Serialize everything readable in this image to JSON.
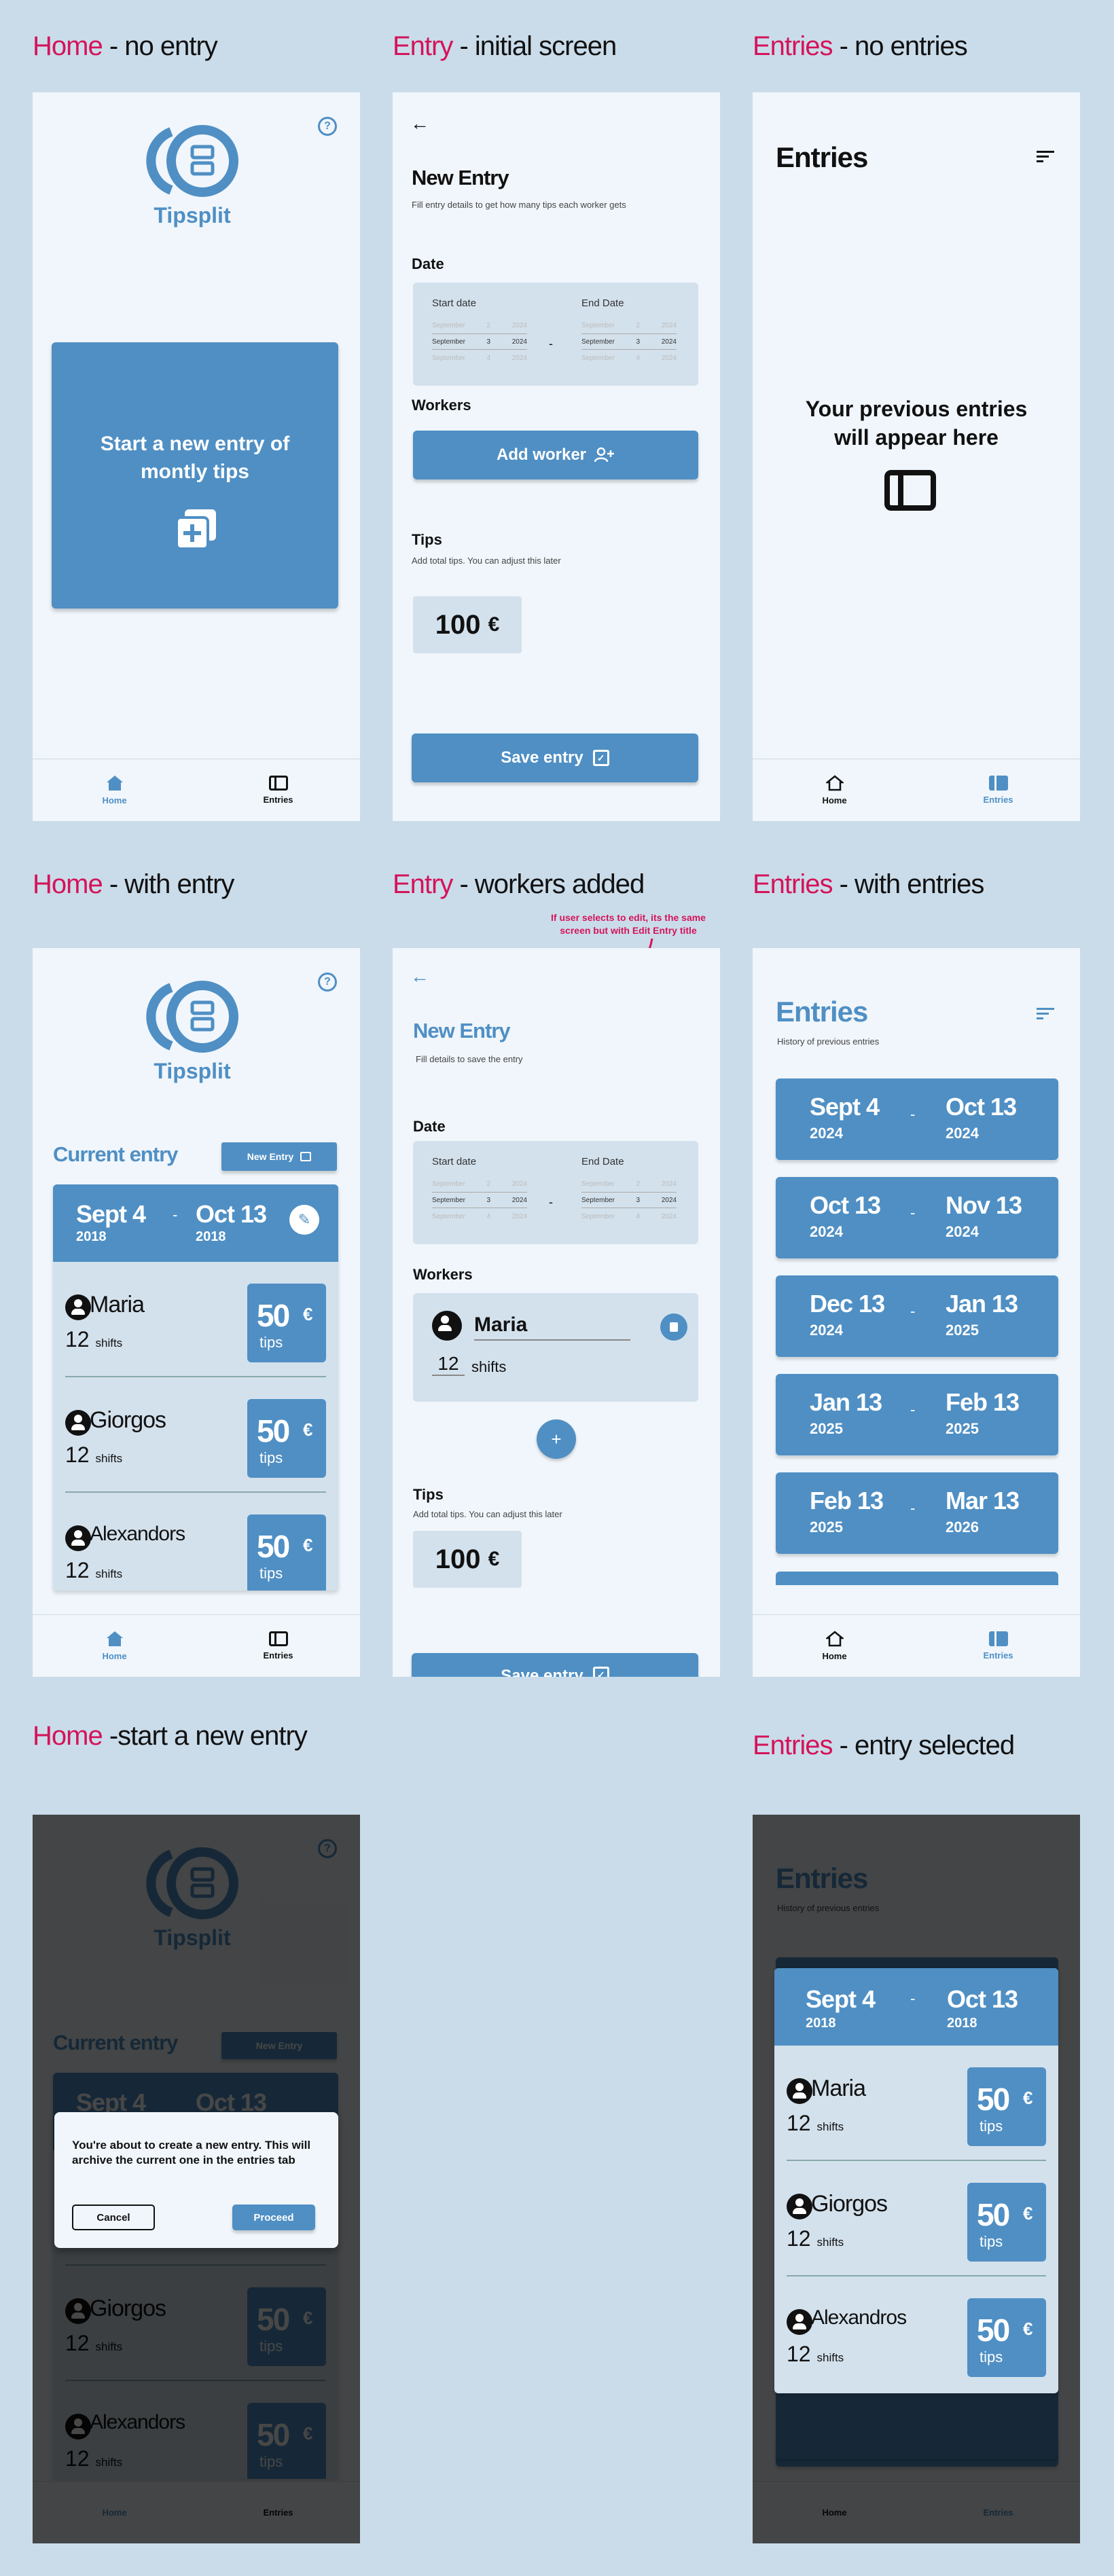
{
  "labels": {
    "home_no_entry": {
      "hl": "Home",
      "rest": " - no entry"
    },
    "entry_initial": {
      "hl": "Entry",
      "rest": " - initial screen"
    },
    "entries_none": {
      "hl": "Entries",
      "rest": " - no entries"
    },
    "home_with_entry": {
      "hl": "Home",
      "rest": " - with entry"
    },
    "entry_workers": {
      "hl": "Entry",
      "rest": " - workers added"
    },
    "entries_with": {
      "hl": "Entries",
      "rest": " - with entries"
    },
    "home_start_new": {
      "hl": "Home",
      "rest": " -start a new entry"
    },
    "entries_selected": {
      "hl": "Entries",
      "rest": " - entry selected"
    }
  },
  "annotation": "If user selects to edit, its the same screen but with Edit Entry title",
  "colors": {
    "accent": "#4f8fc4",
    "highlight": "#d4145a",
    "background": "#cadcea",
    "surface": "#f0f6fb",
    "panel": "#d3e1ec"
  },
  "app": {
    "name": "Tipsplit",
    "help": "?"
  },
  "nav": {
    "home": "Home",
    "entries": "Entries"
  },
  "home": {
    "cta": "Start a new entry of montly tips",
    "current_entry": "Current entry",
    "new_entry_btn": "New Entry"
  },
  "entry": {
    "title": "New Entry",
    "subtitle_initial": "Fill entry details to get how many tips each worker gets",
    "subtitle_workers": "Fill details to save the entry",
    "date_label": "Date",
    "start_date": "Start date",
    "end_date": "End Date",
    "month": "September",
    "day_prev": "2",
    "day": "3",
    "day_next": "4",
    "year": "2024",
    "workers_label": "Workers",
    "add_worker": "Add worker",
    "tips_label": "Tips",
    "tips_sub": "Add total tips. You can adjust this later",
    "tips_value": "100",
    "currency": "€",
    "save": "Save entry",
    "worker_name": "Maria",
    "worker_shifts": "12",
    "shifts_word": "shifts",
    "add": "+"
  },
  "entries": {
    "title": "Entries",
    "subtitle": "History of previous entries",
    "empty": "Your previous entries will appear here",
    "list": [
      {
        "start": "Sept 4",
        "start_year": "2024",
        "end": "Oct 13",
        "end_year": "2024"
      },
      {
        "start": "Oct 13",
        "start_year": "2024",
        "end": "Nov 13",
        "end_year": "2024"
      },
      {
        "start": "Dec 13",
        "start_year": "2024",
        "end": "Jan 13",
        "end_year": "2025"
      },
      {
        "start": "Jan 13",
        "start_year": "2025",
        "end": "Feb 13",
        "end_year": "2025"
      },
      {
        "start": "Feb 13",
        "start_year": "2025",
        "end": "Mar 13",
        "end_year": "2026"
      }
    ]
  },
  "current": {
    "start": "Sept 4",
    "start_year": "2018",
    "end": "Oct 13",
    "end_year": "2018",
    "workers": [
      {
        "name": "Maria",
        "shifts": "12",
        "tips": "50"
      },
      {
        "name": "Giorgos",
        "shifts": "12",
        "tips": "50"
      },
      {
        "name": "Alexandors",
        "shifts": "12",
        "tips": "50"
      }
    ],
    "workers_selected": [
      {
        "name": "Maria",
        "shifts": "12",
        "tips": "50"
      },
      {
        "name": "Giorgos",
        "shifts": "12",
        "tips": "50"
      },
      {
        "name": "Alexandros",
        "shifts": "12",
        "tips": "50"
      }
    ],
    "shifts_word": "shifts",
    "tips_word": "tips",
    "currency": "€"
  },
  "dialog": {
    "message": "You're about to create a new entry. This will archive the current one in the entries tab",
    "cancel": "Cancel",
    "proceed": "Proceed"
  }
}
